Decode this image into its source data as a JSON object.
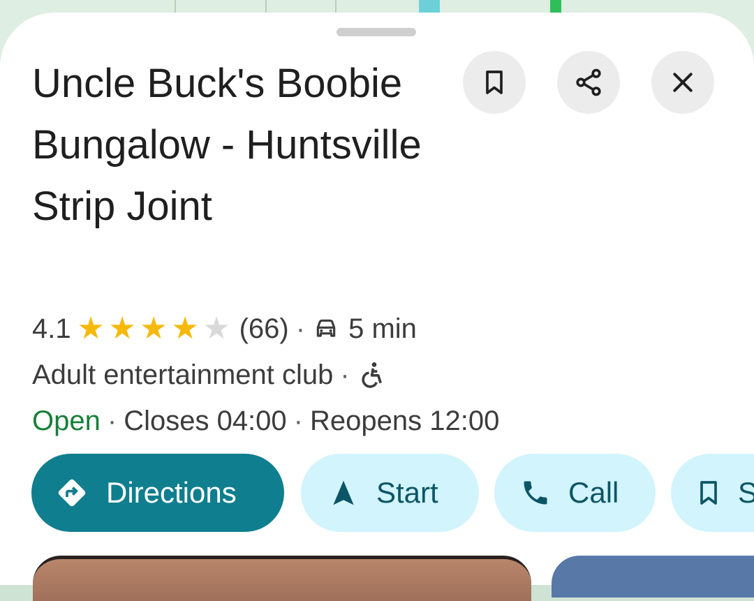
{
  "place": {
    "name": "Uncle Buck's Boobie Bungalow - Huntsville Strip Joint",
    "rating": "4.1",
    "rating_value": 4.1,
    "rating_max": 5,
    "reviews": "(66)",
    "drive_time": "5 min",
    "category": "Adult entertainment club",
    "status": "Open",
    "closes": "Closes 04:00",
    "reopens": "Reopens 12:00",
    "separator": "·"
  },
  "actions": {
    "directions": "Directions",
    "start": "Start",
    "call": "Call",
    "save": "S"
  },
  "icons": {
    "save": "bookmark-icon",
    "share": "share-icon",
    "close": "close-icon",
    "drive": "car-icon",
    "accessibility": "wheelchair-icon",
    "directions": "directions-diamond-icon",
    "start": "navigation-arrow-icon",
    "call": "phone-icon"
  },
  "colors": {
    "primary": "#0f7e8e",
    "secondary": "#d2f4fc",
    "open": "#188038",
    "star": "#f6b90a"
  }
}
